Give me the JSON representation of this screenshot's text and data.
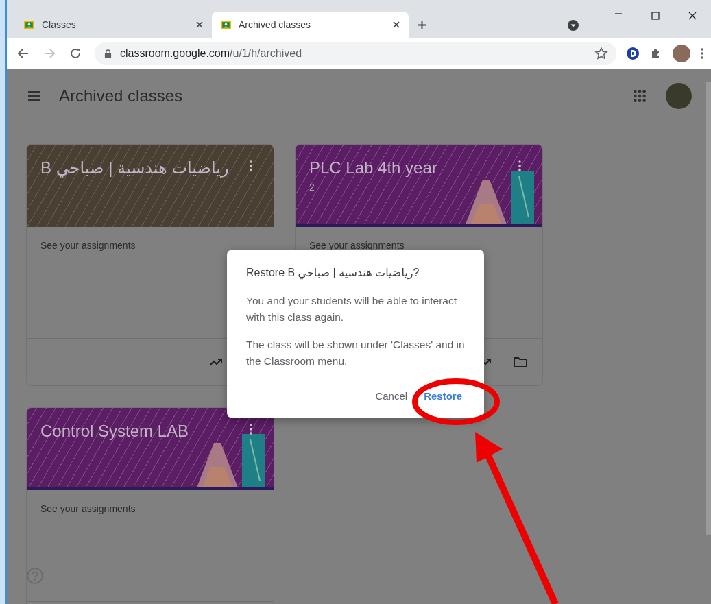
{
  "browser": {
    "tabs": [
      {
        "title": "Classes",
        "selected": false
      },
      {
        "title": "Archived classes",
        "selected": true
      }
    ],
    "url": {
      "host": "classroom.google.com",
      "path": "/u/1/h/archived"
    }
  },
  "app_bar": {
    "title": "Archived classes"
  },
  "classes": [
    {
      "name": "رياضيات هندسية | صباحي B",
      "kind": "photo",
      "link": "See your assignments"
    },
    {
      "name": "PLC Lab 4th year",
      "section": "2",
      "kind": "lab",
      "link": "See your assignments"
    },
    {
      "name": "Control System LAB",
      "kind": "lab",
      "link": "See your assignments"
    }
  ],
  "dialog": {
    "title": "Restore B رياضيات هندسية | صباحي?",
    "paragraphs": [
      "You and your students will be able to interact with this class again.",
      "The class will be shown under 'Classes' and in the Classroom menu."
    ],
    "buttons": [
      {
        "label": "Cancel",
        "kind": "text"
      },
      {
        "label": "Restore",
        "kind": "primary"
      }
    ]
  }
}
